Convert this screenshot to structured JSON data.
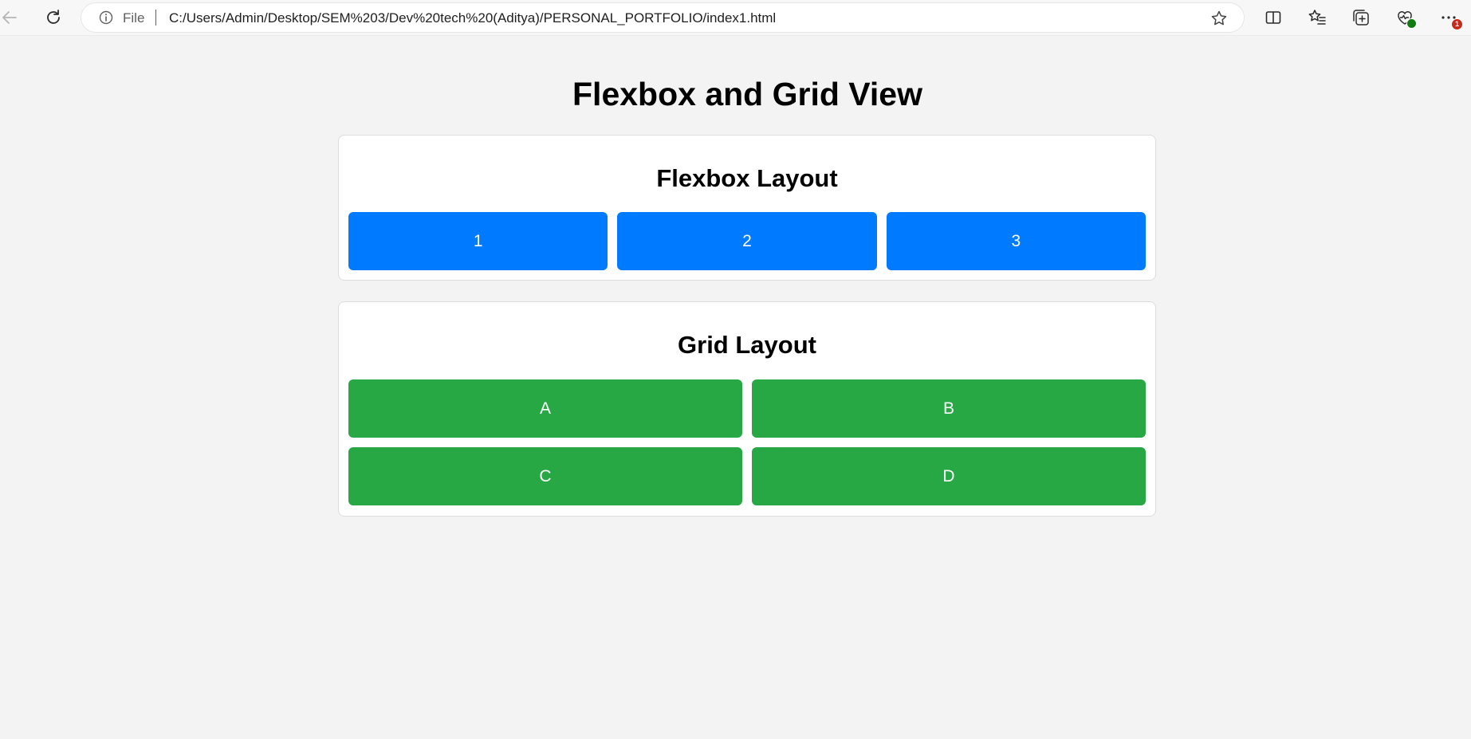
{
  "browser": {
    "address_bar": {
      "scheme_label": "File",
      "url": "C:/Users/Admin/Desktop/SEM%203/Dev%20tech%20(Aditya)/PERSONAL_PORTFOLIO/index1.html"
    },
    "icons": [
      "back-icon",
      "refresh-icon",
      "info-icon",
      "favorite-star-icon",
      "split-screen-icon",
      "favorites-icon",
      "collections-icon",
      "browser-essentials-icon",
      "more-menu-icon"
    ],
    "notification_badge": "1",
    "colors": {
      "badge_green": "#107c10",
      "badge_red": "#c42b1c"
    }
  },
  "page": {
    "title": "Flexbox and Grid View",
    "flexbox": {
      "heading": "Flexbox Layout",
      "items": [
        "1",
        "2",
        "3"
      ],
      "color": "#007bff"
    },
    "grid": {
      "heading": "Grid Layout",
      "items": [
        "A",
        "B",
        "C",
        "D"
      ],
      "color": "#28a745"
    },
    "background": "#f3f3f3"
  }
}
